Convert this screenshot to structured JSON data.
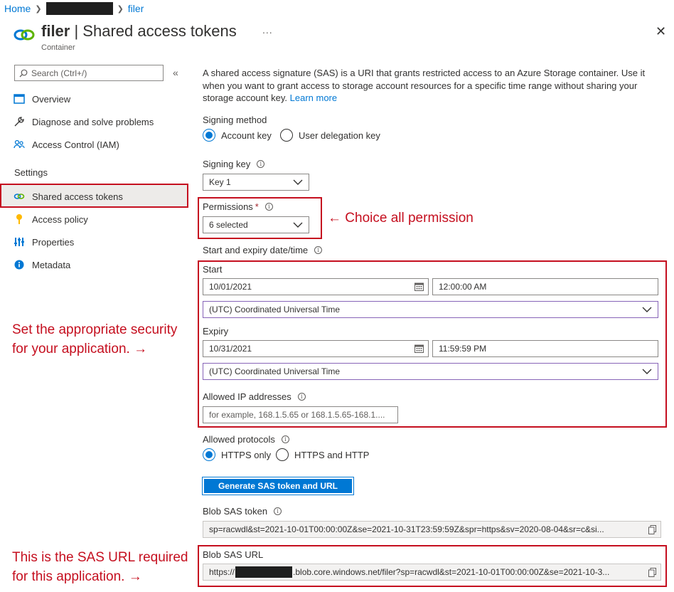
{
  "breadcrumb": {
    "home": "Home",
    "current": "filer",
    "separator": ">"
  },
  "header": {
    "title_bold": "filer",
    "title_rest": " | Shared access tokens",
    "subtitle": "Container",
    "more": "...",
    "close": "✕"
  },
  "sidebar": {
    "search_placeholder": "Search (Ctrl+/)",
    "collapse": "«",
    "items": [
      {
        "label": "Overview",
        "icon": "overview-icon"
      },
      {
        "label": "Diagnose and solve problems",
        "icon": "wrench-icon"
      },
      {
        "label": "Access Control (IAM)",
        "icon": "people-icon"
      }
    ],
    "settings_header": "Settings",
    "settings_items": [
      {
        "label": "Shared access tokens",
        "icon": "link-icon",
        "active": true
      },
      {
        "label": "Access policy",
        "icon": "key-icon"
      },
      {
        "label": "Properties",
        "icon": "properties-icon"
      },
      {
        "label": "Metadata",
        "icon": "info-icon"
      }
    ]
  },
  "main": {
    "description": "A shared access signature (SAS) is a URI that grants restricted access to an Azure Storage container. Use it when you want to grant access to storage account resources for a specific time range without sharing your storage account key.",
    "learn_more": "Learn more",
    "signing_method": {
      "label": "Signing method",
      "options": [
        "Account key",
        "User delegation key"
      ],
      "selected": "Account key"
    },
    "signing_key": {
      "label": "Signing key",
      "value": "Key 1"
    },
    "permissions": {
      "label": "Permissions",
      "required": "*",
      "value": "6 selected"
    },
    "start_expiry_label": "Start and expiry date/time",
    "start": {
      "label": "Start",
      "date": "10/01/2021",
      "time": "12:00:00 AM",
      "timezone": "(UTC) Coordinated Universal Time"
    },
    "expiry": {
      "label": "Expiry",
      "date": "10/31/2021",
      "time": "11:59:59 PM",
      "timezone": "(UTC) Coordinated Universal Time"
    },
    "allowed_ip": {
      "label": "Allowed IP addresses",
      "placeholder": "for example, 168.1.5.65 or 168.1.5.65-168.1...."
    },
    "allowed_protocols": {
      "label": "Allowed protocols",
      "options": [
        "HTTPS only",
        "HTTPS and HTTP"
      ],
      "selected": "HTTPS only"
    },
    "generate_button": "Generate SAS token and URL",
    "blob_sas_token": {
      "label": "Blob SAS token",
      "value": "sp=racwdl&st=2021-10-01T00:00:00Z&se=2021-10-31T23:59:59Z&spr=https&sv=2020-08-04&sr=c&si..."
    },
    "blob_sas_url": {
      "label": "Blob SAS URL",
      "prefix": "https://",
      "value": ".blob.core.windows.net/filer?sp=racwdl&st=2021-10-01T00:00:00Z&se=2021-10-3..."
    }
  },
  "annotations": {
    "permissions": "← Choice all permission",
    "security_line1": "Set the appropriate security",
    "security_line2": "for your application. →",
    "url_line1": "This is the SAS URL required",
    "url_line2": "for this application. →"
  },
  "colors": {
    "accent": "#0078d4",
    "annotation": "#c50f1f",
    "text": "#323130"
  }
}
